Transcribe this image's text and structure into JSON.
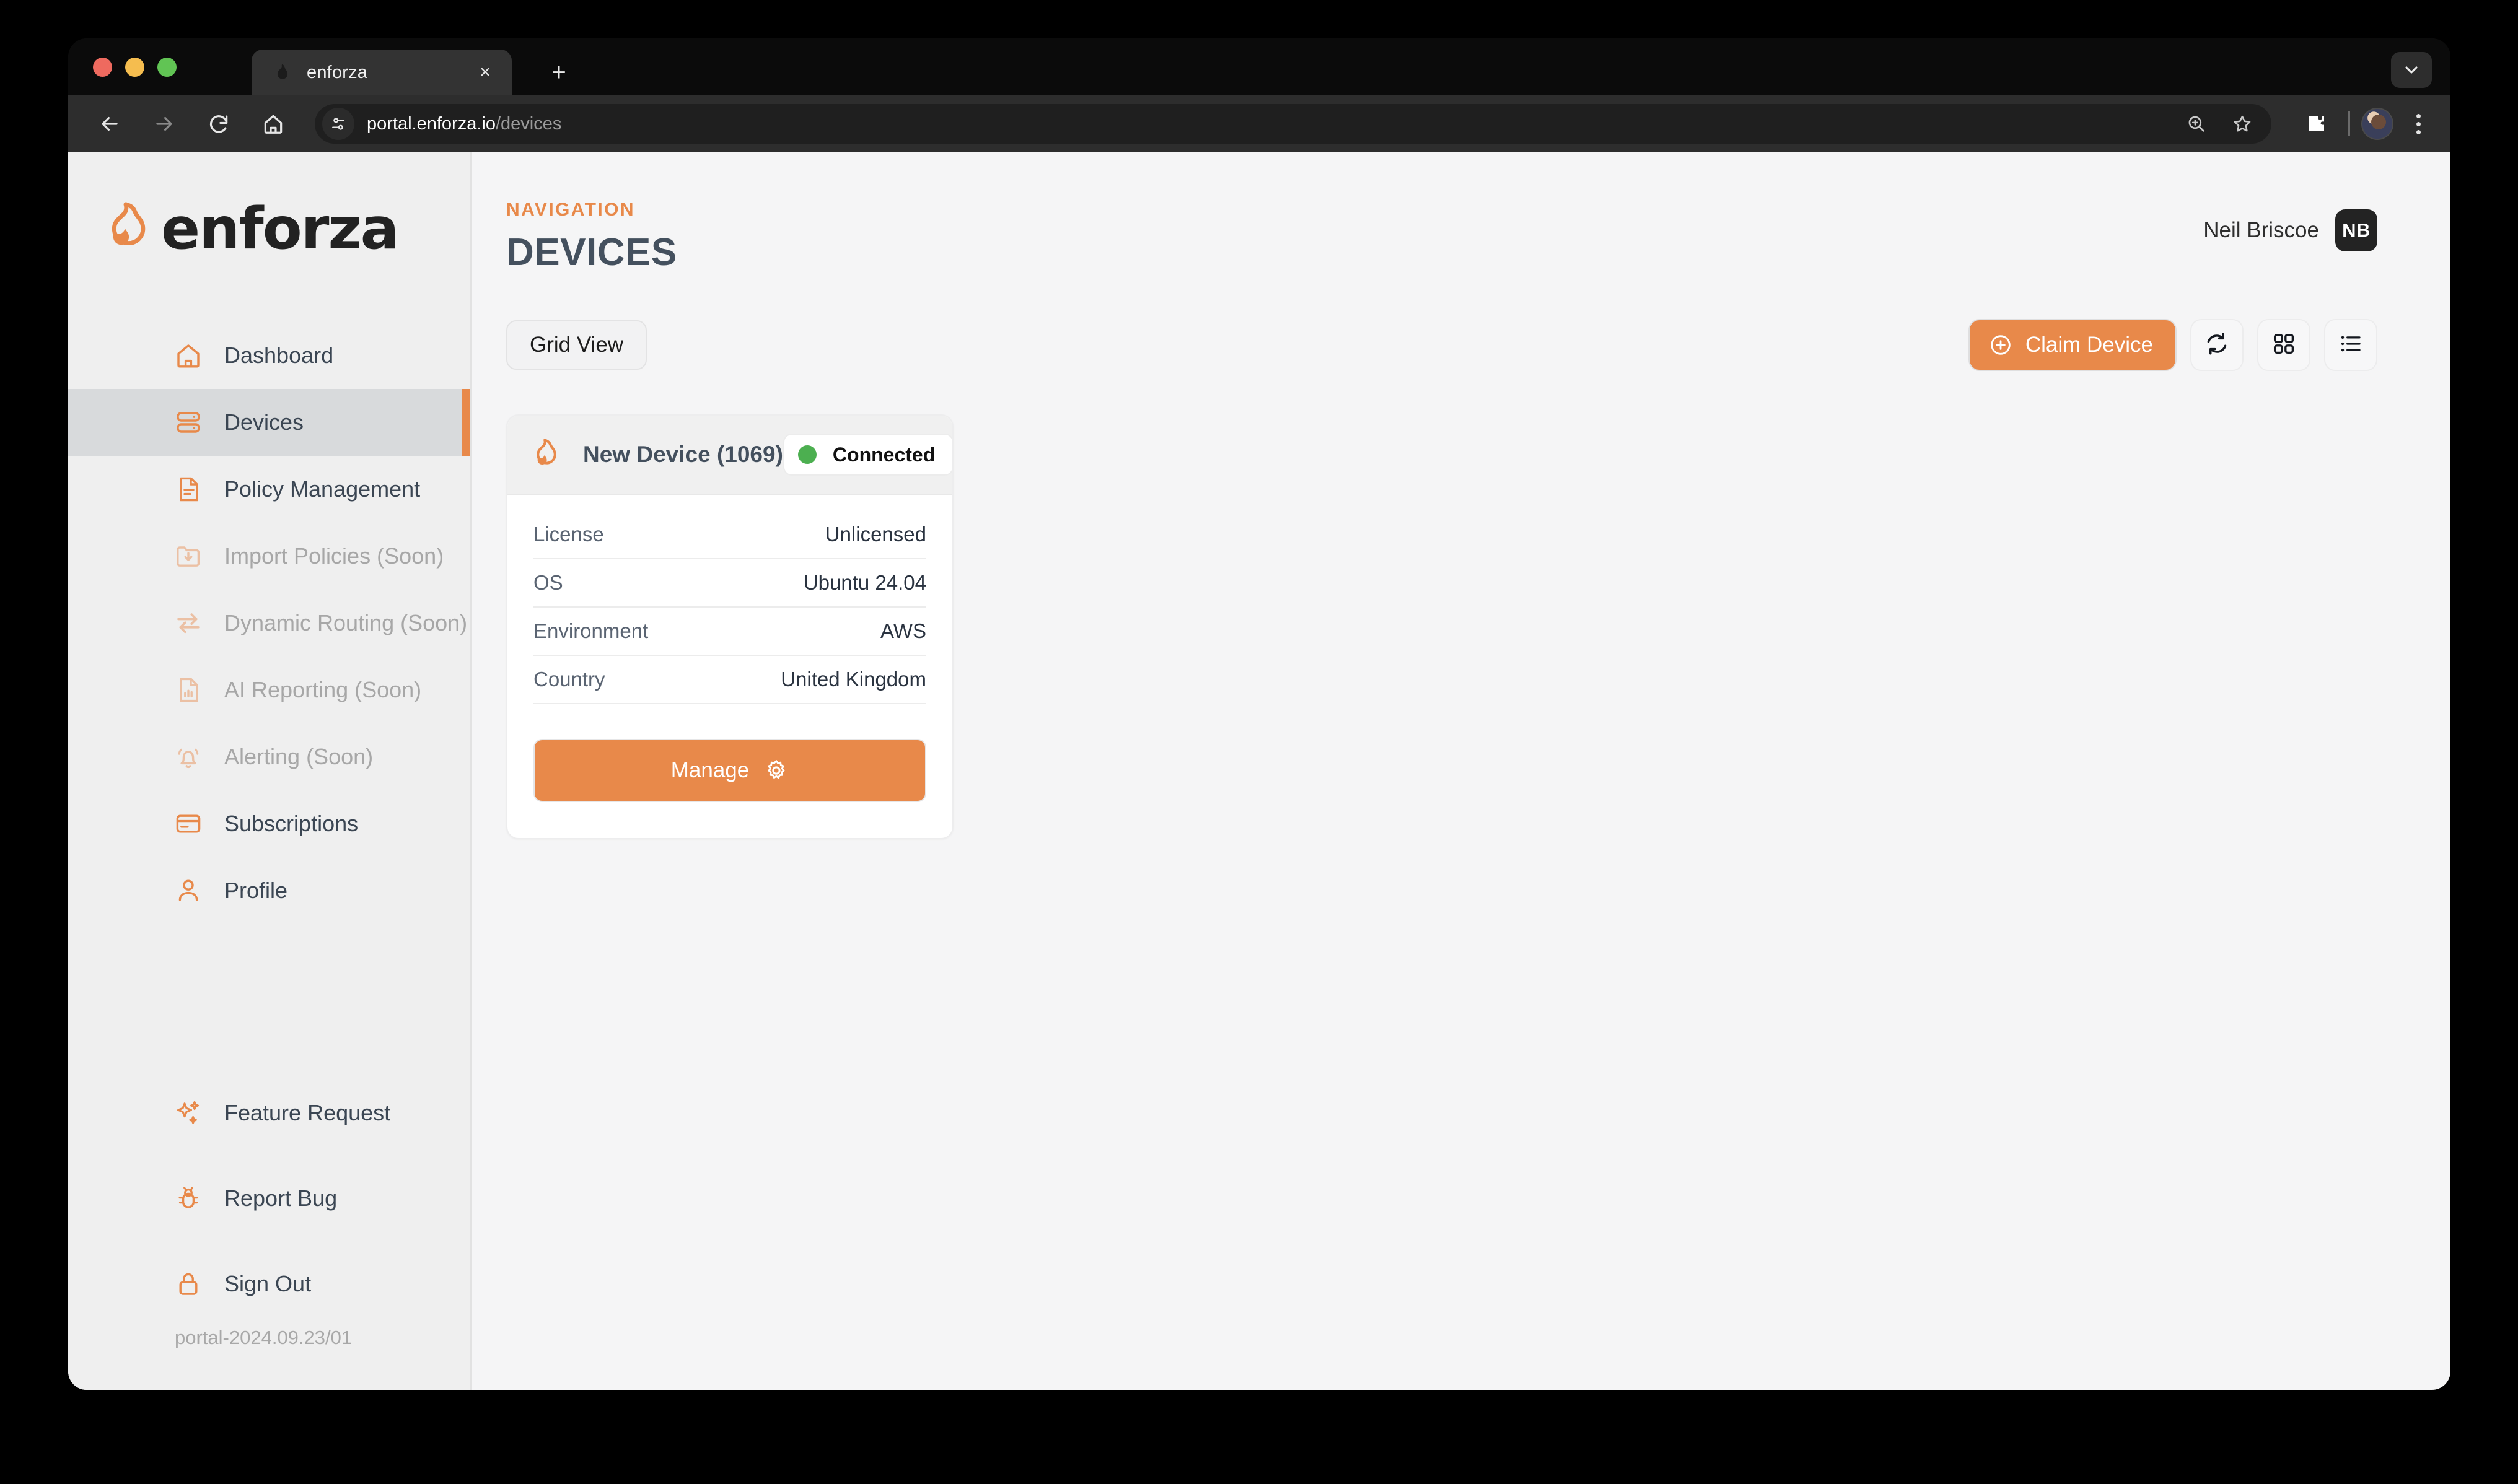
{
  "browser": {
    "tab": {
      "title": "enforza",
      "favicon": "flame-icon",
      "close": "×"
    },
    "new_tab": "+",
    "url_domain": "portal.enforza.io",
    "url_path": "/devices",
    "nav": {
      "back": "back-icon",
      "forward": "forward-icon",
      "reload": "reload-icon",
      "home": "home-icon"
    },
    "omnibox_actions": [
      "zoom-icon",
      "bookmark-star-icon"
    ],
    "toolbar_actions": [
      "extensions-icon",
      "profile-avatar",
      "chrome-menu-icon"
    ]
  },
  "sidebar": {
    "logo_word": "enforza",
    "logo_mark": "flame-icon",
    "primary_items": [
      {
        "label": "Dashboard",
        "icon": "home-icon",
        "active": false,
        "disabled": false
      },
      {
        "label": "Devices",
        "icon": "server-icon",
        "active": true,
        "disabled": false
      },
      {
        "label": "Policy Management",
        "icon": "document-icon",
        "active": false,
        "disabled": false
      },
      {
        "label": "Import Policies (Soon)",
        "icon": "folder-down-icon",
        "active": false,
        "disabled": true
      },
      {
        "label": "Dynamic Routing (Soon)",
        "icon": "exchange-icon",
        "active": false,
        "disabled": true
      },
      {
        "label": "AI Reporting (Soon)",
        "icon": "chart-doc-icon",
        "active": false,
        "disabled": true
      },
      {
        "label": "Alerting (Soon)",
        "icon": "bell-icon",
        "active": false,
        "disabled": true
      },
      {
        "label": "Subscriptions",
        "icon": "credit-card-icon",
        "active": false,
        "disabled": false
      },
      {
        "label": "Profile",
        "icon": "user-icon",
        "active": false,
        "disabled": false
      }
    ],
    "footer_items": [
      {
        "label": "Feature Request",
        "icon": "sparkles-icon"
      },
      {
        "label": "Report Bug",
        "icon": "bug-icon"
      },
      {
        "label": "Sign Out",
        "icon": "lock-icon"
      }
    ],
    "version": "portal-2024.09.23/01"
  },
  "header": {
    "eyebrow": "NAVIGATION",
    "title": "DEVICES",
    "user_name": "Neil Briscoe",
    "user_initials": "NB"
  },
  "toolbar": {
    "view_toggle_label": "Grid View",
    "claim_device_label": "Claim Device",
    "refresh_icon": "refresh-icon",
    "grid_icon": "grid-icon",
    "list_icon": "list-icon"
  },
  "device_card": {
    "name": "New Device (1069)",
    "icon": "flame-icon",
    "status": "Connected",
    "status_color": "#4caf50",
    "details": [
      {
        "label": "License",
        "value": "Unlicensed"
      },
      {
        "label": "OS",
        "value": "Ubuntu 24.04"
      },
      {
        "label": "Environment",
        "value": "AWS"
      },
      {
        "label": "Country",
        "value": "United Kingdom"
      }
    ],
    "manage_label": "Manage"
  },
  "colors": {
    "accent": "#e8894a",
    "page_bg": "#f5f5f6",
    "sidebar_bg": "#efefef",
    "active_bg": "#d8dadc",
    "title": "#44505e",
    "status_green": "#4caf50"
  }
}
